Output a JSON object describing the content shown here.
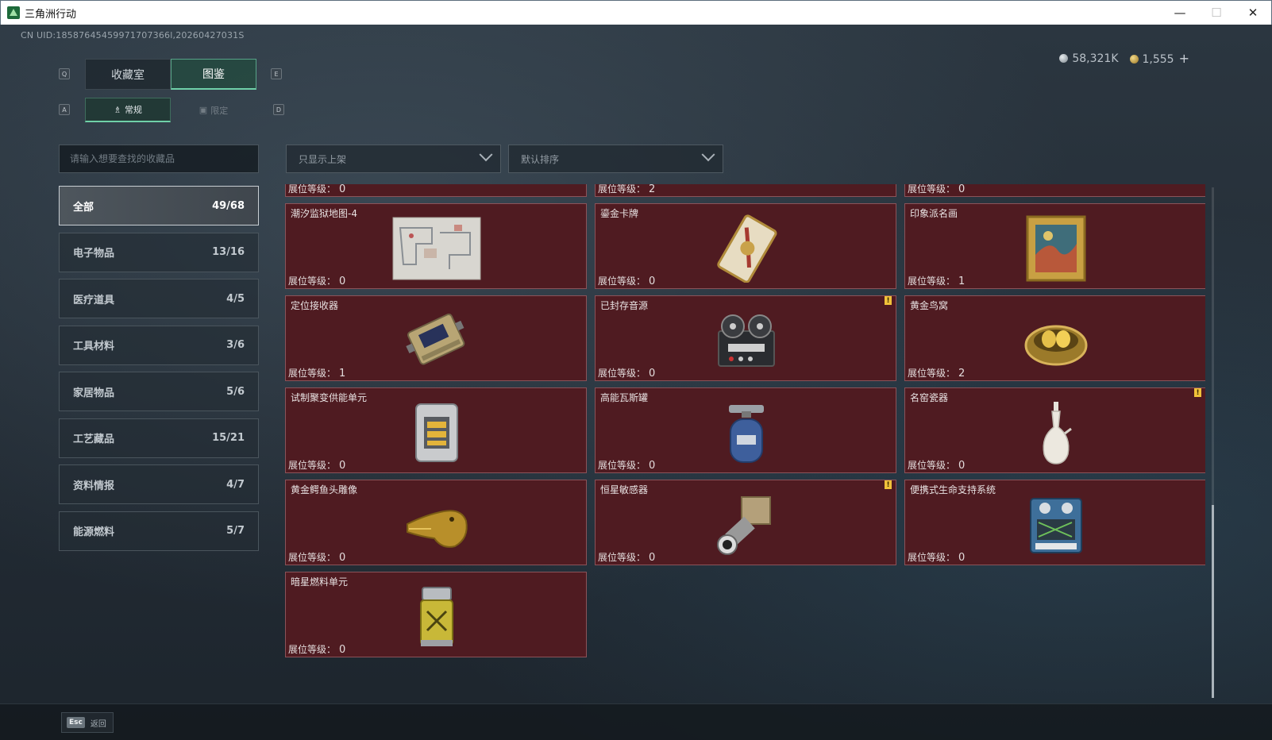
{
  "window": {
    "title": "三角洲行动",
    "minimize": "—",
    "maximize": "☐",
    "close": "✕"
  },
  "uid": "CN UID:18587645459971707366l,20260427031S",
  "currency": {
    "silver_value": "58,321K",
    "gold_value": "1,555",
    "add_label": "+"
  },
  "key_hints": {
    "q": "Q",
    "e": "E",
    "a": "A",
    "d": "D"
  },
  "tabs": [
    {
      "label": "收藏室"
    },
    {
      "label": "图鉴"
    }
  ],
  "subtabs": [
    {
      "label": "常规"
    },
    {
      "label": "限定"
    }
  ],
  "search": {
    "placeholder": "请输入想要查找的收藏品"
  },
  "filters": {
    "shelf_filter": "只显示上架",
    "sort": "默认排序"
  },
  "categories": [
    {
      "label": "全部",
      "count": "49/68"
    },
    {
      "label": "电子物品",
      "count": "13/16"
    },
    {
      "label": "医疗道具",
      "count": "4/5"
    },
    {
      "label": "工具材料",
      "count": "3/6"
    },
    {
      "label": "家居物品",
      "count": "5/6"
    },
    {
      "label": "工艺藏品",
      "count": "15/21"
    },
    {
      "label": "资料情报",
      "count": "4/7"
    },
    {
      "label": "能源燃料",
      "count": "5/7"
    }
  ],
  "level_label": "展位等级：",
  "items": [
    {
      "name": "",
      "level": "0",
      "icon": "unknown-item-icon"
    },
    {
      "name": "",
      "level": "2",
      "icon": "unknown-item-icon"
    },
    {
      "name": "",
      "level": "0",
      "icon": "unknown-item-icon"
    },
    {
      "name": "潮汐监狱地图-4",
      "level": "0",
      "icon": "prison-map-icon"
    },
    {
      "name": "鎏金卡牌",
      "level": "0",
      "icon": "gilded-card-icon"
    },
    {
      "name": "印象派名画",
      "level": "1",
      "icon": "framed-painting-icon"
    },
    {
      "name": "定位接收器",
      "level": "1",
      "icon": "gps-receiver-icon"
    },
    {
      "name": "已封存音源",
      "level": "0",
      "icon": "reel-to-reel-recorder-icon",
      "badge": "!"
    },
    {
      "name": "黄金鸟窝",
      "level": "2",
      "icon": "golden-nest-icon"
    },
    {
      "name": "试制聚变供能单元",
      "level": "0",
      "icon": "fusion-cell-icon"
    },
    {
      "name": "高能瓦斯罐",
      "level": "0",
      "icon": "gas-canister-icon"
    },
    {
      "name": "名窑瓷器",
      "level": "0",
      "icon": "porcelain-vase-icon",
      "badge": "!"
    },
    {
      "name": "黄金鳄鱼头雕像",
      "level": "0",
      "icon": "golden-crocodile-head-icon"
    },
    {
      "name": "恒星敏感器",
      "level": "0",
      "icon": "star-sensor-icon",
      "badge": "!"
    },
    {
      "name": "便携式生命支持系统",
      "level": "0",
      "icon": "life-support-system-icon"
    },
    {
      "name": "暗星燃料单元",
      "level": "0",
      "icon": "fuel-cell-icon"
    }
  ],
  "footer": {
    "esc_key": "Esc",
    "esc_label": "返回"
  },
  "colors": {
    "accent": "#6fd0a8",
    "card_bg": "#4f1b21",
    "card_border": "#8b5359",
    "badge": "#f0c23a"
  }
}
